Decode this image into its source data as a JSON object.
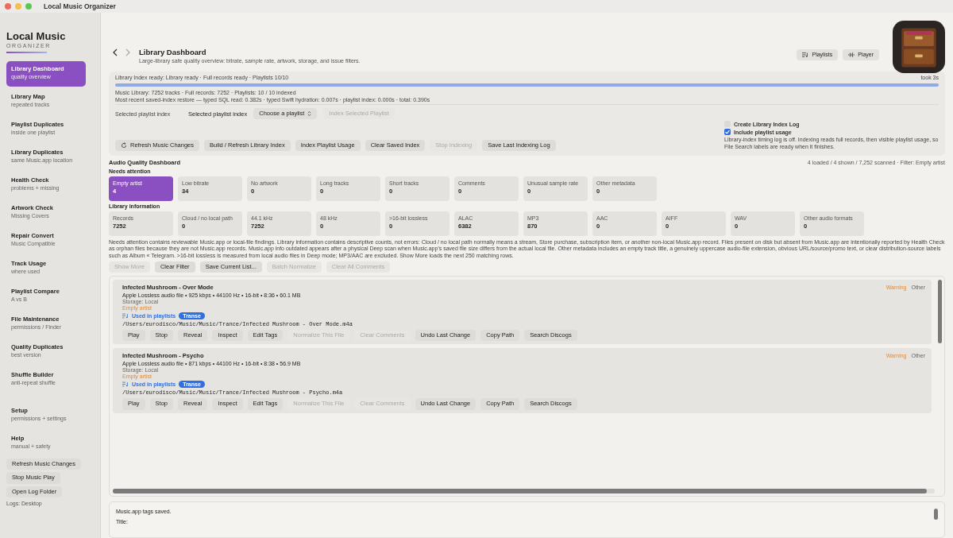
{
  "window": {
    "title": "Local Music Organizer"
  },
  "sidebar": {
    "brand": {
      "title": "Local Music",
      "subtitle": "ORGANIZER"
    },
    "items": [
      {
        "label": "Library Dashboard",
        "sub": "quality overview",
        "selected": true
      },
      {
        "label": "Library Map",
        "sub": "repeated tracks",
        "selected": false
      },
      {
        "label": "Playlist Duplicates",
        "sub": "inside one playlist",
        "selected": false
      },
      {
        "label": "Library Duplicates",
        "sub": "same Music.app location",
        "selected": false
      },
      {
        "label": "Health Check",
        "sub": "problems + missing",
        "selected": false
      },
      {
        "label": "Artwork Check",
        "sub": "Missing Covers",
        "selected": false
      },
      {
        "label": "Repair Convert",
        "sub": "Music Compatible",
        "selected": false
      },
      {
        "label": "Track Usage",
        "sub": "where used",
        "selected": false
      },
      {
        "label": "Playlist Compare",
        "sub": "A vs B",
        "selected": false
      },
      {
        "label": "File Maintenance",
        "sub": "permissions / Finder",
        "selected": false
      },
      {
        "label": "Quality Duplicates",
        "sub": "best version",
        "selected": false
      },
      {
        "label": "Shuffle Builder",
        "sub": "anti-repeat shuffle",
        "selected": false
      }
    ],
    "bottom_items": [
      {
        "label": "Setup",
        "sub": "permissions + settings",
        "selected": false
      },
      {
        "label": "Help",
        "sub": "manual + safety",
        "selected": false
      }
    ],
    "buttons": [
      "Refresh Music Changes",
      "Stop Music Play",
      "Open Log Folder"
    ],
    "footer": "Logs: Desktop"
  },
  "header": {
    "title": "Library Dashboard",
    "subtitle": "Large-library safe quality overview: bitrate, sample rate, artwork, storage, and issue filters.",
    "buttons": [
      {
        "label": "Playlists"
      },
      {
        "label": "Player"
      }
    ]
  },
  "index": {
    "status": "Library Index ready: Library ready · Full records ready · Playlists 10/10",
    "took": "took 3s",
    "level": 1.0,
    "lines": [
      "Music Library: 7252 tracks · Full records: 7252 · Playlists: 10 / 10 indexed",
      "Most recent saved-index restore — typed SQL read: 0.382s · typed Swift hydration: 0.007s · playlist index: 0.000s · total: 0.390s"
    ],
    "playlist_caption": "Selected playlist index",
    "playlist_label": "Selected playlist index",
    "playlist_select": "Choose a playlist",
    "playlist_button": {
      "label": "Index Selected Playlist",
      "disabled": true
    },
    "buttons": [
      {
        "label": "Refresh Music Changes",
        "disabled": false
      },
      {
        "label": "Build / Refresh Library Index",
        "disabled": false
      },
      {
        "label": "Index Playlist Usage",
        "disabled": false
      },
      {
        "label": "Clear Saved Index",
        "disabled": false
      },
      {
        "label": "Stop Indexing",
        "disabled": true
      },
      {
        "label": "Save Last Indexing Log",
        "disabled": false
      }
    ],
    "options": [
      {
        "label": "Create Library Index Log",
        "checked": false
      },
      {
        "label": "Include playlist usage",
        "checked": true
      }
    ],
    "note": "Library-index timing log is off. Indexing reads full records, then visible playlist usage, so File Search labels are ready when it finishes."
  },
  "dashboard": {
    "title": "Audio Quality Dashboard",
    "summary": "4 loaded / 4 shown / 7,252 scanned · Filter: Empty artist",
    "groups": [
      {
        "title": "Needs attention",
        "tiles": [
          {
            "label": "Empty artist",
            "value": "4",
            "selected": true
          },
          {
            "label": "Low bitrate",
            "value": "34",
            "selected": false
          },
          {
            "label": "No artwork",
            "value": "0",
            "selected": false
          },
          {
            "label": "Long tracks",
            "value": "0",
            "selected": false
          },
          {
            "label": "Short tracks",
            "value": "0",
            "selected": false
          },
          {
            "label": "Comments",
            "value": "0",
            "selected": false
          },
          {
            "label": "Unusual sample rate",
            "value": "0",
            "selected": false
          },
          {
            "label": "Other metadata",
            "value": "0",
            "selected": false
          }
        ]
      },
      {
        "title": "Library information",
        "tiles": [
          {
            "label": "Records",
            "value": "7252",
            "selected": false
          },
          {
            "label": "Cloud / no local path",
            "value": "0",
            "selected": false
          },
          {
            "label": "44.1 kHz",
            "value": "7252",
            "selected": false
          },
          {
            "label": "48 kHz",
            "value": "0",
            "selected": false
          },
          {
            "label": ">16-bit lossless",
            "value": "0",
            "selected": false
          },
          {
            "label": "ALAC",
            "value": "6382",
            "selected": false
          },
          {
            "label": "MP3",
            "value": "870",
            "selected": false
          },
          {
            "label": "AAC",
            "value": "0",
            "selected": false
          },
          {
            "label": "AIFF",
            "value": "0",
            "selected": false
          },
          {
            "label": "WAV",
            "value": "0",
            "selected": false
          },
          {
            "label": "Other audio formats",
            "value": "0",
            "selected": false
          }
        ]
      }
    ],
    "note": "Needs attention contains reviewable Music.app or local-file findings. Library information contains descriptive counts, not errors: Cloud / no local path normally means a stream, Store purchase, subscription item, or another non-local Music.app record. Files present on disk but absent from Music.app are intentionally reported by Health Check as orphan files because they are not Music.app records. Music.app info outdated appears after a physical Deep scan when Music.app's saved file size differs from the actual local file. Other metadata includes an empty track title, a genuinely uppercase audio-file extension, obvious URL/source/promo text, or clear distribution-source labels such as Album « Telegram. >16-bit lossless is measured from local audio files in Deep mode; MP3/AAC are excluded. Show More loads the next 250 matching rows.",
    "actions": [
      {
        "label": "Show More",
        "disabled": true
      },
      {
        "label": "Clear Filter",
        "disabled": false
      },
      {
        "label": "Save Current List...",
        "disabled": false
      },
      {
        "label": "Batch Normalize",
        "disabled": true
      },
      {
        "label": "Clear All Comments",
        "disabled": true
      }
    ]
  },
  "tracks": [
    {
      "title": "Infected Mushroom - Over Mode",
      "details": "Apple Lossless audio file • 925 kbps • 44100 Hz • 16-bit • 8:36 • 60.1 MB",
      "storage": "Storage: Local",
      "issue": "Empty artist",
      "severity": "Warning",
      "category": "Other",
      "playlists_label": "Used in playlists",
      "playlists": [
        "Transe"
      ],
      "path": "/Users/eurodisco/Music/Music/Trance/Infected Mushroom - Over Mode.m4a",
      "actions": [
        {
          "label": "Play",
          "disabled": false
        },
        {
          "label": "Stop",
          "disabled": false
        },
        {
          "label": "Reveal",
          "disabled": false
        },
        {
          "label": "Inspect",
          "disabled": false
        },
        {
          "label": "Edit Tags",
          "disabled": false
        },
        {
          "label": "Normalize This File",
          "disabled": true
        },
        {
          "label": "Clear Comments",
          "disabled": true
        },
        {
          "label": "Undo Last Change",
          "disabled": false
        },
        {
          "label": "Copy Path",
          "disabled": false
        },
        {
          "label": "Search Discogs",
          "disabled": false
        }
      ]
    },
    {
      "title": "Infected Mushroom - Psycho",
      "details": "Apple Lossless audio file • 871 kbps • 44100 Hz • 16-bit • 8:38 • 56.9 MB",
      "storage": "Storage: Local",
      "issue": "Empty artist",
      "severity": "Warning",
      "category": "Other",
      "playlists_label": "Used in playlists",
      "playlists": [
        "Transe"
      ],
      "path": "/Users/eurodisco/Music/Music/Trance/Infected Mushroom - Psycho.m4a",
      "actions": [
        {
          "label": "Play",
          "disabled": false
        },
        {
          "label": "Stop",
          "disabled": false
        },
        {
          "label": "Reveal",
          "disabled": false
        },
        {
          "label": "Inspect",
          "disabled": false
        },
        {
          "label": "Edit Tags",
          "disabled": false
        },
        {
          "label": "Normalize This File",
          "disabled": true
        },
        {
          "label": "Clear Comments",
          "disabled": true
        },
        {
          "label": "Undo Last Change",
          "disabled": false
        },
        {
          "label": "Copy Path",
          "disabled": false
        },
        {
          "label": "Search Discogs",
          "disabled": false
        }
      ]
    }
  ],
  "log": {
    "lines": [
      "Music.app tags saved.",
      "Title:"
    ]
  }
}
